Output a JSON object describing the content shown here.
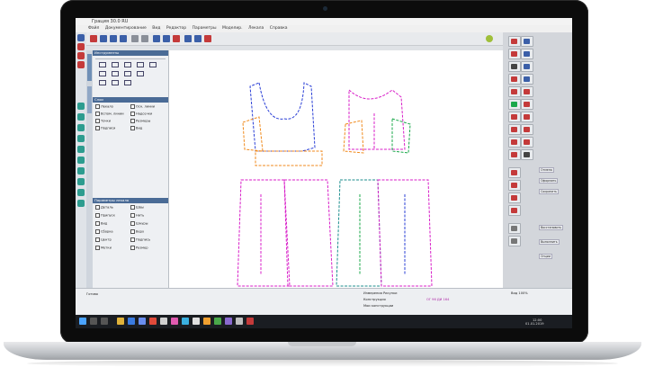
{
  "window": {
    "title": "Грация 30.0 RU"
  },
  "menu": [
    "Файл",
    "Документирование",
    "Вид",
    "Редактор",
    "Параметры",
    "Моделир.",
    "Лекала",
    "Справка"
  ],
  "panels": {
    "tools_header": "Инструменты",
    "layers_header": "Слои",
    "layers_items": [
      "Лекало",
      "Осн. линии",
      "Вспом. линии",
      "Надсечки",
      "Точки",
      "Размеры",
      "Подписи",
      "Вид"
    ],
    "properties_header": "Параметры лекала",
    "checklist_items": [
      "Деталь",
      "Швы",
      "Припуск",
      "Нить",
      "Вид",
      "Шнуры",
      "Сборка",
      "Верх",
      "Центр",
      "Подпись",
      "Метки",
      "Размер"
    ]
  },
  "right_panel": {
    "labels": [
      "Отмена",
      "Оформить",
      "Сохранить",
      "Восстановить",
      "Выполнить",
      "Опции"
    ]
  },
  "status": {
    "left": "Готово",
    "center_top": "Измерения Рисунки",
    "center_mid": "Конструкция",
    "center_line": "Мои конструкции",
    "sizes": "ОГ 96 ДИ 164",
    "right_top": "Вид 100%"
  },
  "taskbar": {
    "time": "12:00",
    "date": "01.01.2019"
  },
  "icons": [
    "windows-icon",
    "search-icon",
    "task-view-icon",
    "folder-icon",
    "browser-icon",
    "mail-icon"
  ],
  "colors": {
    "pattern_blue": "#2a3fd6",
    "pattern_magenta": "#d81ec8",
    "pattern_orange": "#f08a1c",
    "pattern_green": "#1aa84a",
    "pattern_teal": "#1c8e8e",
    "pattern_red": "#d8283a"
  }
}
